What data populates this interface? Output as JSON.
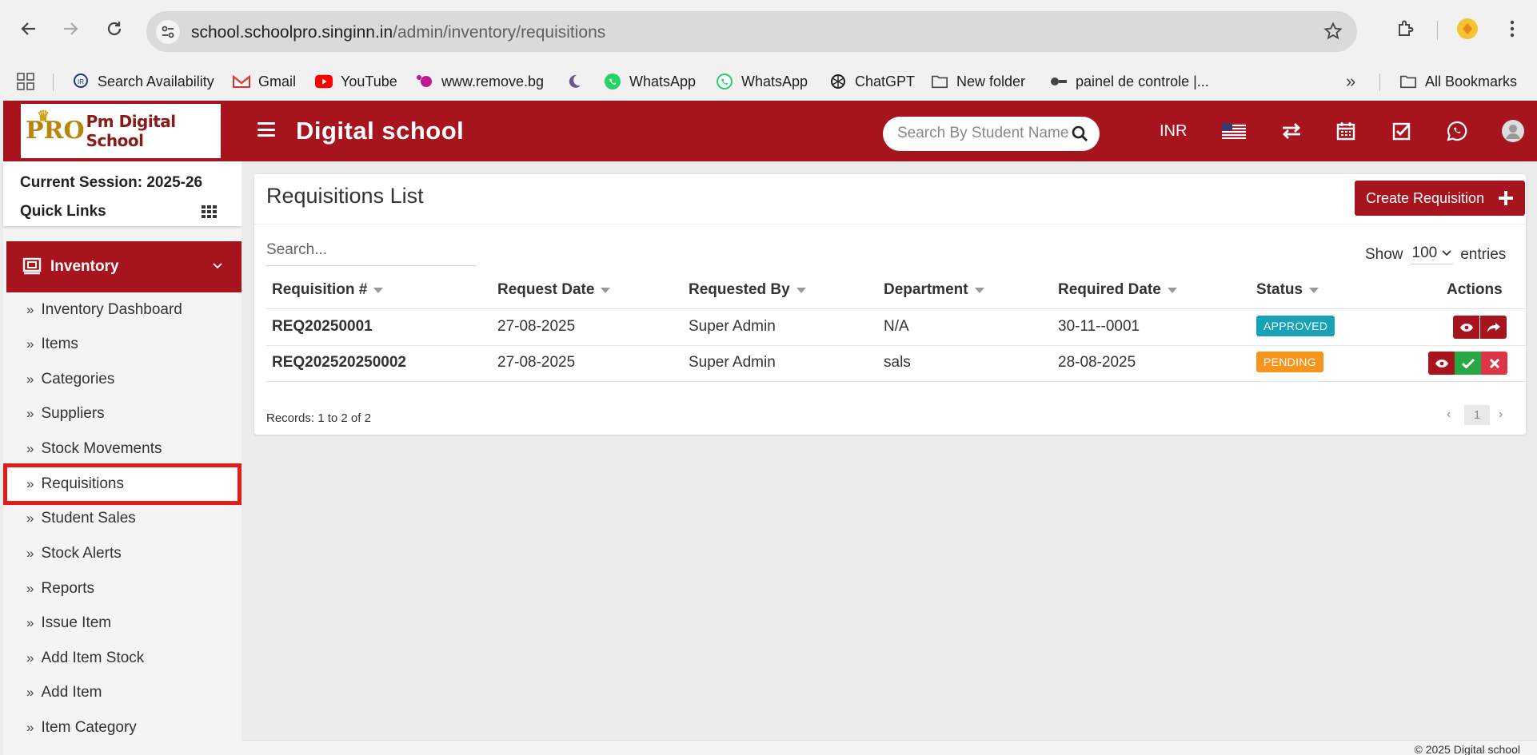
{
  "browser": {
    "url_host": "school.schoolpro.singinn.in",
    "url_path": "/admin/inventory/requisitions",
    "bookmarks": [
      {
        "label": "Search Availability",
        "icon": "irctc-icon"
      },
      {
        "label": "Gmail",
        "icon": "gmail-icon"
      },
      {
        "label": "YouTube",
        "icon": "youtube-icon"
      },
      {
        "label": "www.remove.bg",
        "icon": "removebg-icon"
      },
      {
        "label": "",
        "icon": "moon-icon"
      },
      {
        "label": "WhatsApp",
        "icon": "whatsapp-icon"
      },
      {
        "label": "WhatsApp",
        "icon": "whatsapp-icon"
      },
      {
        "label": "ChatGPT",
        "icon": "chatgpt-icon"
      },
      {
        "label": "New folder",
        "icon": "folder-icon"
      },
      {
        "label": "painel de controle |...",
        "icon": "controle-icon"
      }
    ],
    "all_bookmarks": "All Bookmarks",
    "more": "»"
  },
  "header": {
    "logo_pro": "PRO",
    "logo_text": "Pm Digital School",
    "title": "Digital school",
    "search_placeholder": "Search By Student Name",
    "currency": "INR",
    "accent_color": "#a8141e"
  },
  "sidebar": {
    "session": "Current Session: 2025-26",
    "quick_links": "Quick Links",
    "section": "Inventory",
    "items": [
      {
        "label": "Inventory Dashboard"
      },
      {
        "label": "Items"
      },
      {
        "label": "Categories"
      },
      {
        "label": "Suppliers"
      },
      {
        "label": "Stock Movements"
      },
      {
        "label": "Requisitions"
      },
      {
        "label": "Student Sales"
      },
      {
        "label": "Stock Alerts"
      },
      {
        "label": "Reports"
      },
      {
        "label": "Issue Item"
      },
      {
        "label": "Add Item Stock"
      },
      {
        "label": "Add Item"
      },
      {
        "label": "Item Category"
      }
    ],
    "active_item": "Requisitions"
  },
  "main": {
    "title": "Requisitions List",
    "create_label": "Create Requisition",
    "search_placeholder": "Search...",
    "show_label": "Show",
    "entries_value": "100",
    "entries_label": "entries",
    "columns": [
      "Requisition #",
      "Request Date",
      "Requested By",
      "Department",
      "Required Date",
      "Status",
      "Actions"
    ],
    "rows": [
      {
        "id": "REQ20250001",
        "request_date": "27-08-2025",
        "requested_by": "Super Admin",
        "department": "N/A",
        "required_date": "30-11--0001",
        "status": "APPROVED",
        "status_color": "#17a2b8"
      },
      {
        "id": "REQ202520250002",
        "request_date": "27-08-2025",
        "requested_by": "Super Admin",
        "department": "sals",
        "required_date": "28-08-2025",
        "status": "PENDING",
        "status_color": "#f7941d"
      }
    ],
    "records": "Records: 1 to 2 of 2",
    "page": "1",
    "prev": "‹",
    "next": "›"
  },
  "footer": {
    "text": "© 2025 Digital school"
  }
}
